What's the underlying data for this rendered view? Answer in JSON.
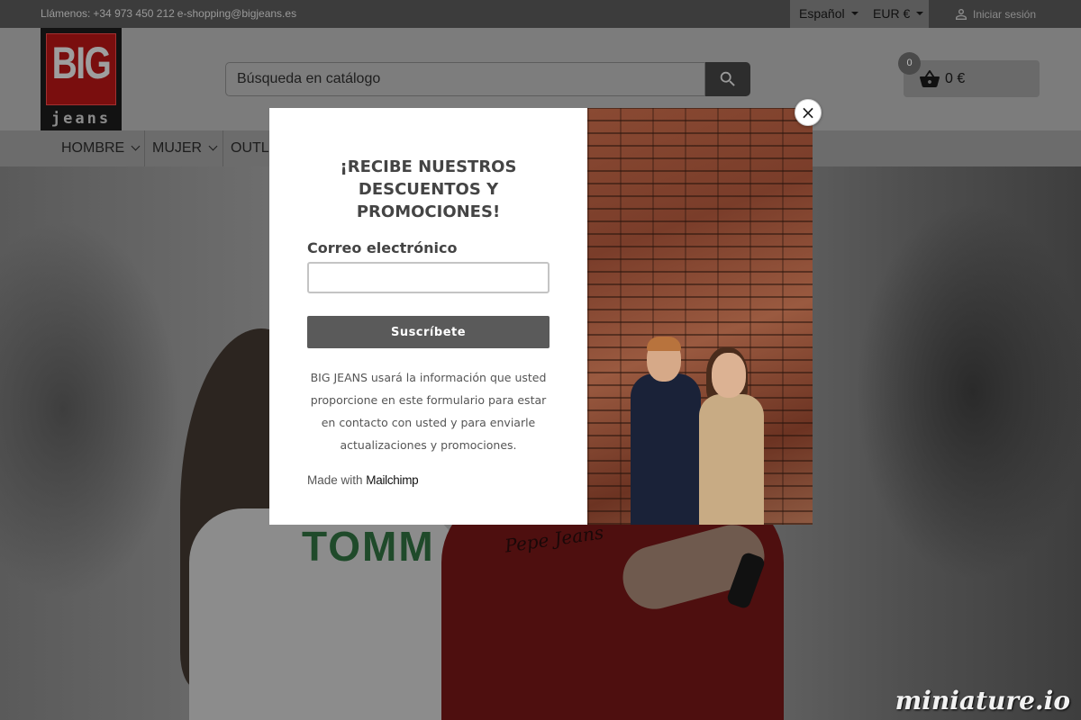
{
  "topbar": {
    "contact_label": "Llámenos:",
    "phone": "+34 973 450 212",
    "email": "e-shopping@bigjeans.es",
    "language": "Español",
    "currency": "EUR €",
    "signin": "Iniciar sesión"
  },
  "logo": {
    "big": "BIG",
    "jeans": "jeans"
  },
  "search": {
    "placeholder": "Búsqueda en catálogo"
  },
  "cart": {
    "count": "0",
    "total": "0 €"
  },
  "nav": {
    "items": [
      "HOMBRE",
      "MUJER",
      "OUTLET"
    ]
  },
  "hero": {
    "shirt_text_1": "TOMM",
    "shirt_text_2": "Pepe Jeans"
  },
  "modal": {
    "title": "¡RECIBE NUESTROS DESCUENTOS Y PROMOCIONES!",
    "email_label": "Correo electrónico",
    "subscribe_label": "Suscríbete",
    "disclaimer": "BIG JEANS usará la información que usted proporcione en este formulario para estar en contacto con usted y para enviarle actualizaciones y promociones.",
    "made_with": "Made with",
    "mailchimp": "Mailchimp",
    "close": "×"
  },
  "watermark": "miniature.io",
  "colors": {
    "overlay_dark": "#3c3c3c",
    "button": "#5a5a5a",
    "modal_bg": "#ffffff"
  },
  "icons": {
    "search": "search-icon",
    "cart": "basket-icon",
    "user": "user-icon",
    "close": "close-icon"
  }
}
